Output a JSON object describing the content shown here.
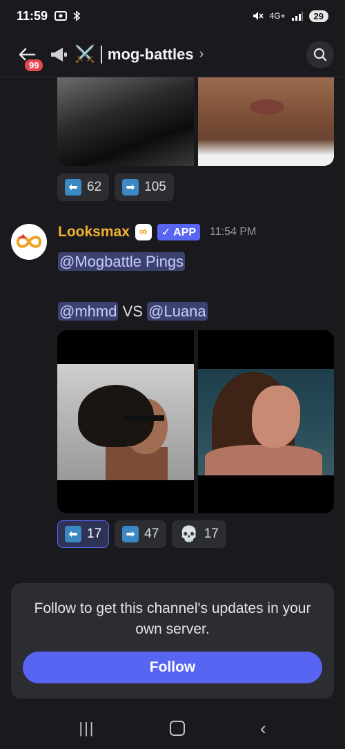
{
  "status_bar": {
    "time": "11:59",
    "network": "4G+",
    "battery": "29"
  },
  "header": {
    "notification_count": "99",
    "channel_name": "mog-battles",
    "chevron": "›"
  },
  "previous_message": {
    "reactions": [
      {
        "emoji": "left-arrow",
        "count": "62"
      },
      {
        "emoji": "right-arrow",
        "count": "105"
      }
    ]
  },
  "message": {
    "author": "Looksmax",
    "author_badge": "∞",
    "app_tag": "✓ APP",
    "timestamp": "11:54 PM",
    "ping_mention": "@Mogbattle Pings",
    "battle": {
      "left_mention": "@mhmd",
      "vs_text": "VS",
      "right_mention": "@Luana"
    },
    "reactions": [
      {
        "emoji": "left-arrow",
        "count": "17",
        "active": true
      },
      {
        "emoji": "right-arrow",
        "count": "47",
        "active": false
      },
      {
        "emoji": "skull",
        "count": "17",
        "active": false
      }
    ]
  },
  "follow_card": {
    "text": "Follow to get this channel's updates in your own server.",
    "button_label": "Follow"
  },
  "icons": {
    "back": "back-arrow-icon",
    "announcement": "megaphone-icon",
    "crossed_swords": "crossed-swords-icon",
    "search": "search-icon"
  },
  "colors": {
    "background": "#1a1a1e",
    "accent": "#5865f2",
    "username": "#f0b232",
    "badge_red": "#e8484f"
  }
}
